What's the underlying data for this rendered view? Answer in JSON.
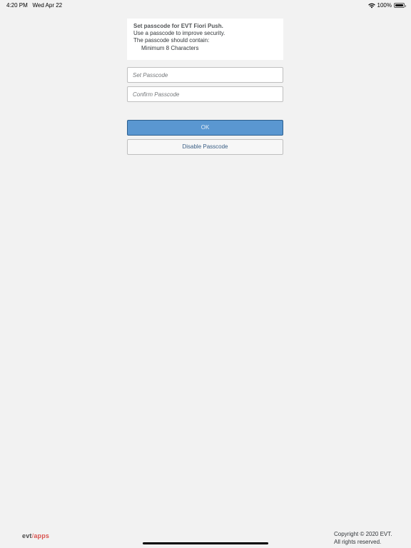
{
  "status_bar": {
    "time": "4:20 PM",
    "date": "Wed Apr 22",
    "battery": "100%",
    "battery_level": 1.0
  },
  "info": {
    "title": "Set passcode for EVT Fiori Push.",
    "line1": "Use a passcode to improve security.",
    "line2": "The passcode should contain:",
    "requirement": "Minimum 8 Characters"
  },
  "form": {
    "set_placeholder": "Set Passcode",
    "confirm_placeholder": "Confirm Passcode",
    "ok_label": "OK",
    "disable_label": "Disable Passcode"
  },
  "footer": {
    "logo_evt": "evt",
    "logo_sep": "/",
    "logo_apps": "apps",
    "copyright_line1": "Copyright © 2020 EVT.",
    "copyright_line2": "All rights reserved."
  },
  "colors": {
    "background": "#f2f2f2",
    "primary_button": "#5a97d1",
    "brand_accent": "#d9534f"
  },
  "icons": [
    "wifi-icon",
    "battery-icon"
  ]
}
